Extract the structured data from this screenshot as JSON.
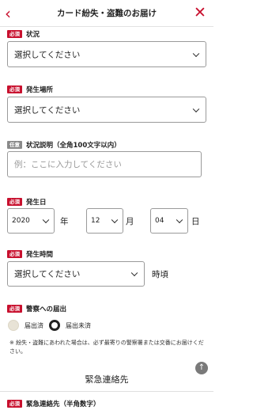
{
  "header": {
    "back_icon": "chevron-left-icon",
    "title": "カード紛失・盗難のお届け",
    "close_icon": "close-icon",
    "accent": "#c8102e"
  },
  "badges": {
    "required": "必須",
    "optional": "任意"
  },
  "fields": {
    "status": {
      "label": "状況",
      "value": "選択してください"
    },
    "location": {
      "label": "発生場所",
      "value": "選択してください"
    },
    "description": {
      "label": "状況説明（全角100文字以内）",
      "placeholder": "例：ここに入力してください"
    },
    "date": {
      "label": "発生日",
      "year": "2020",
      "year_unit": "年",
      "month": "12",
      "month_unit": "月",
      "day": "04",
      "day_unit": "日"
    },
    "time": {
      "label": "発生時間",
      "value": "選択してください",
      "unit": "時頃"
    },
    "police": {
      "label": "警察への届出",
      "options": [
        "届出済",
        "届出未済"
      ],
      "selected": "届出未済",
      "note": "※ 紛失・盗難にあわれた場合は、必ず最寄りの警察署または交番にお届けください。"
    }
  },
  "emergency": {
    "section_title": "緊急連絡先",
    "field_label": "緊急連絡先（半角数字）"
  },
  "scroll_top_icon": "arrow-up-icon"
}
